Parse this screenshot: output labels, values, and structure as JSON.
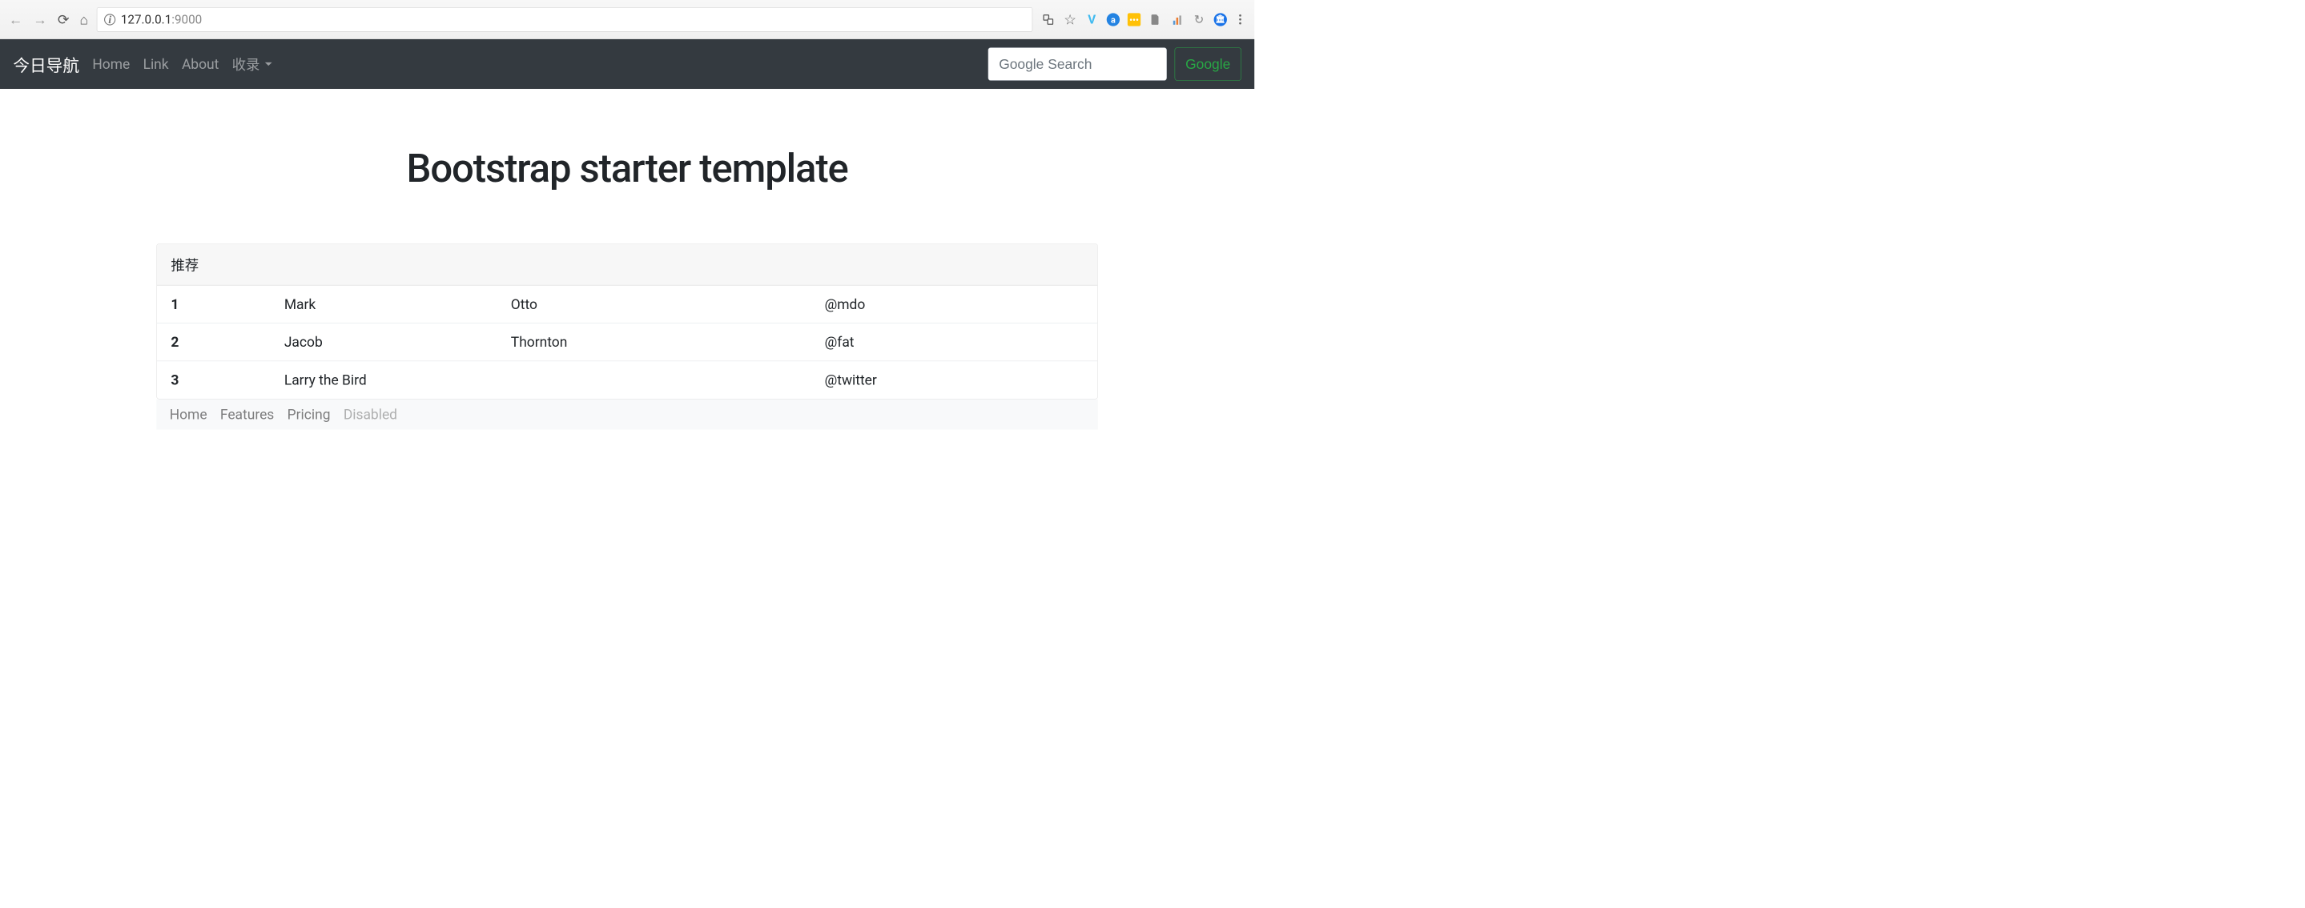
{
  "browser": {
    "url_host": "127.0.0.1",
    "url_port": ":9000"
  },
  "navbar": {
    "brand": "今日导航",
    "items": [
      {
        "label": "Home"
      },
      {
        "label": "Link"
      },
      {
        "label": "About"
      },
      {
        "label": "收录"
      }
    ],
    "search_placeholder": "Google Search",
    "search_button": "Google"
  },
  "main": {
    "title": "Bootstrap starter template",
    "card_header": "推荐",
    "table": {
      "rows": [
        {
          "id": "1",
          "first": "Mark",
          "last": "Otto",
          "handle": "@mdo"
        },
        {
          "id": "2",
          "first": "Jacob",
          "last": "Thornton",
          "handle": "@fat"
        },
        {
          "id": "3",
          "first": "Larry the Bird",
          "last": "",
          "handle": "@twitter"
        }
      ]
    }
  },
  "footer": {
    "items": [
      {
        "label": "Home"
      },
      {
        "label": "Features"
      },
      {
        "label": "Pricing"
      },
      {
        "label": "Disabled"
      }
    ]
  }
}
